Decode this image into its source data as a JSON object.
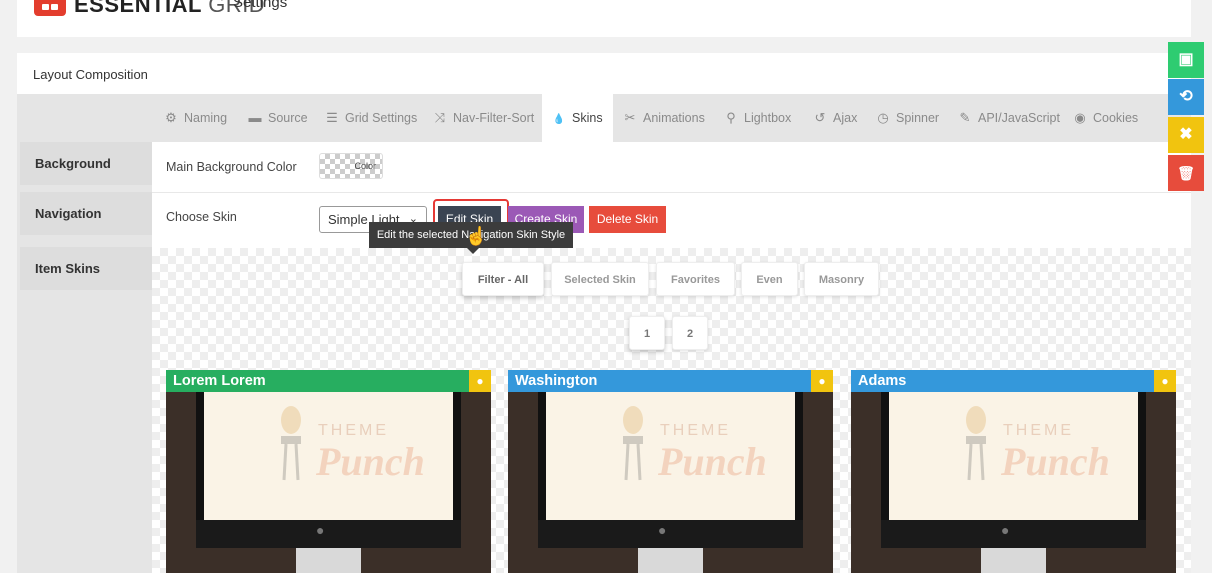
{
  "app": {
    "logo_text_bold": "ESSENTIAL",
    "logo_text_light": "GRID",
    "page_title": "Settings"
  },
  "panel": {
    "title": "Layout Composition"
  },
  "tabs": [
    {
      "label": "Naming",
      "icon": "gear-icon",
      "glyph": "⚙"
    },
    {
      "label": "Source",
      "icon": "folder-icon",
      "glyph": "▬"
    },
    {
      "label": "Grid Settings",
      "icon": "list-icon",
      "glyph": "☰"
    },
    {
      "label": "Nav-Filter-Sort",
      "icon": "shuffle-icon",
      "glyph": "⤨"
    },
    {
      "label": "Skins",
      "icon": "droplet-icon",
      "glyph": "💧"
    },
    {
      "label": "Animations",
      "icon": "tools-icon",
      "glyph": "✂"
    },
    {
      "label": "Lightbox",
      "icon": "search-icon",
      "glyph": "⚲"
    },
    {
      "label": "Ajax",
      "icon": "undo-icon",
      "glyph": "↺"
    },
    {
      "label": "Spinner",
      "icon": "history-icon",
      "glyph": "◷"
    },
    {
      "label": "API/JavaScript",
      "icon": "wand-icon",
      "glyph": "✎"
    },
    {
      "label": "Cookies",
      "icon": "eye-icon",
      "glyph": "◉"
    }
  ],
  "sidenav": [
    {
      "label": "Background"
    },
    {
      "label": "Navigation"
    },
    {
      "label": "Item Skins"
    }
  ],
  "background_row": {
    "label": "Main Background Color",
    "swatch_label": "Color"
  },
  "skin_row": {
    "label": "Choose Skin",
    "selected_skin": "Simple Light",
    "edit_label": "Edit Skin",
    "create_label": "Create Skin",
    "delete_label": "Delete Skin",
    "tooltip": "Edit the selected Navigation Skin Style"
  },
  "preview": {
    "filters": [
      "Filter - All",
      "Selected Skin",
      "Favorites",
      "Even",
      "Masonry"
    ],
    "pages": [
      "1",
      "2"
    ],
    "watermark_small": "THEME",
    "watermark_big": "Punch",
    "cards": [
      {
        "title": "Lorem Lorem",
        "color": "#27ae60"
      },
      {
        "title": "Washington",
        "color": "#3498db"
      },
      {
        "title": "Adams",
        "color": "#3498db"
      }
    ]
  },
  "side_actions": [
    {
      "name": "save-icon",
      "glyph": "▣",
      "color": "#2ecc71"
    },
    {
      "name": "refresh-icon",
      "glyph": "⟲",
      "color": "#3498db"
    },
    {
      "name": "close-icon",
      "glyph": "✖",
      "color": "#f1c40f"
    },
    {
      "name": "trash-icon",
      "glyph": "🗑",
      "color": "#e74c3c"
    }
  ],
  "colors": {
    "brand_red": "#e33d2e",
    "dark_button": "#3a4452",
    "purple": "#9b59b6",
    "red": "#e74c3c",
    "green": "#27ae60",
    "blue": "#3498db",
    "yellow": "#f1c40f"
  }
}
